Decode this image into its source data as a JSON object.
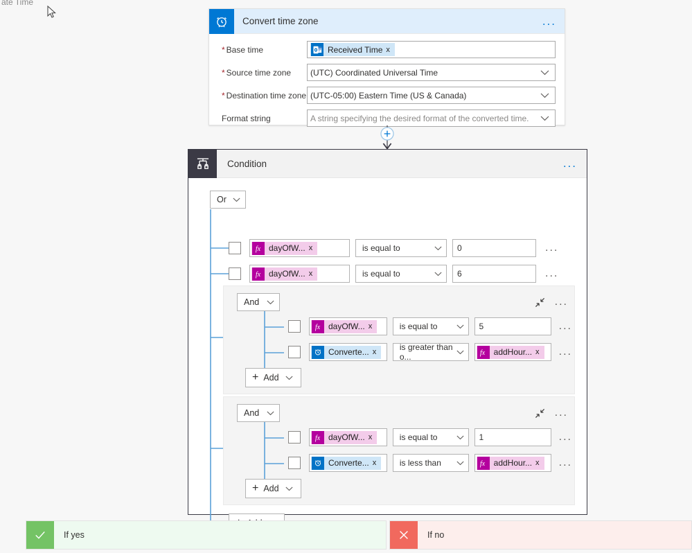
{
  "page": {
    "clipped_text": "ate Time",
    "background": "#f7f7f7"
  },
  "colors": {
    "accent": "#0078d4",
    "token_function": "#b4009e",
    "token_function_bg": "#f3ccea",
    "token_service": "#0072c6",
    "token_service_bg": "#cfe6f7",
    "condition_icon_bg": "#3b3a45",
    "yes_green": "#74c365",
    "no_red": "#f1695e",
    "tree_line": "#5aa0d8"
  },
  "convert_time_zone_card": {
    "icon": "alarm-clock-icon",
    "title": "Convert time zone",
    "menu_label": "...",
    "fields": [
      {
        "label": "Base time",
        "required": true,
        "type": "token",
        "token": {
          "icon": "outlook-icon",
          "kind": "service",
          "text": "Received Time",
          "remove": "x"
        }
      },
      {
        "label": "Source time zone",
        "required": true,
        "type": "dropdown",
        "value": "(UTC) Coordinated Universal Time",
        "is_placeholder": false
      },
      {
        "label": "Destination time zone",
        "required": true,
        "type": "dropdown",
        "value": "(UTC-05:00) Eastern Time (US & Canada)",
        "is_placeholder": false
      },
      {
        "label": "Format string",
        "required": false,
        "type": "dropdown",
        "value": "A string specifying the desired format of the converted time.",
        "is_placeholder": true
      }
    ]
  },
  "connector": {
    "add_label": "+",
    "name": "insert-step-button"
  },
  "condition_card": {
    "icon": "condition-branch-icon",
    "title": "Condition",
    "menu_label": "...",
    "root_operator": "Or",
    "rows": [
      {
        "left": {
          "icon": "fx-icon",
          "kind": "function",
          "text": "dayOfW...",
          "remove": "x"
        },
        "operator": "is equal to",
        "right_type": "text",
        "right": "0",
        "menu_label": "..."
      },
      {
        "left": {
          "icon": "fx-icon",
          "kind": "function",
          "text": "dayOfW...",
          "remove": "x"
        },
        "operator": "is equal to",
        "right_type": "text",
        "right": "6",
        "menu_label": "..."
      }
    ],
    "groups": [
      {
        "operator": "And",
        "collapse_label": "collapse-icon",
        "menu_label": "...",
        "rows": [
          {
            "left": {
              "icon": "fx-icon",
              "kind": "function",
              "text": "dayOfW...",
              "remove": "x"
            },
            "operator": "is equal to",
            "right_type": "text",
            "right": "5",
            "menu_label": "..."
          },
          {
            "left": {
              "icon": "alarm-clock-icon",
              "kind": "service",
              "text": "Converte...",
              "remove": "x"
            },
            "operator": "is greater than o...",
            "right_type": "token",
            "right": {
              "icon": "fx-icon",
              "kind": "function",
              "text": "addHour...",
              "remove": "x"
            },
            "menu_label": "..."
          }
        ],
        "add_label": "Add"
      },
      {
        "operator": "And",
        "collapse_label": "collapse-icon",
        "menu_label": "...",
        "rows": [
          {
            "left": {
              "icon": "fx-icon",
              "kind": "function",
              "text": "dayOfW...",
              "remove": "x"
            },
            "operator": "is equal to",
            "right_type": "text",
            "right": "1",
            "menu_label": "..."
          },
          {
            "left": {
              "icon": "alarm-clock-icon",
              "kind": "service",
              "text": "Converte...",
              "remove": "x"
            },
            "operator": "is less than",
            "right_type": "token",
            "right": {
              "icon": "fx-icon",
              "kind": "function",
              "text": "addHour...",
              "remove": "x"
            },
            "menu_label": "..."
          }
        ],
        "add_label": "Add"
      }
    ],
    "add_label": "Add"
  },
  "branches": [
    {
      "icon": "check-icon",
      "label": "If yes"
    },
    {
      "icon": "cross-icon",
      "label": "If no"
    }
  ]
}
